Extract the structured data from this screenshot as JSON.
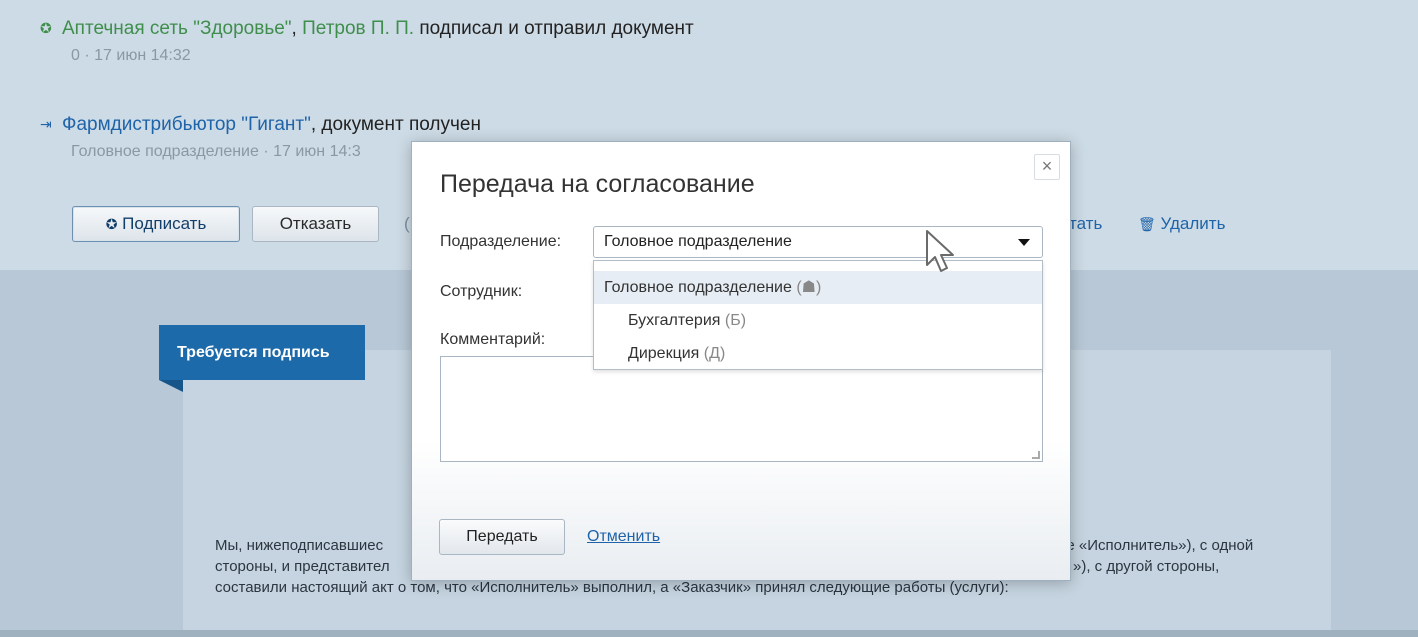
{
  "events": [
    {
      "icon": "certificate-icon",
      "org": "Аптечная сеть \"Здоровье\"",
      "sep": ",",
      "person": "Петров П. П.",
      "action": "подписал и отправил документ",
      "meta_count": "0",
      "meta_dot": "·",
      "meta_time": "17 июн 14:32"
    },
    {
      "icon": "incoming-document-icon",
      "org": "Фармдистрибьютор \"Гигант\"",
      "action": ", документ получен",
      "meta_dept": "Головное подразделение",
      "meta_dot": "·",
      "meta_time": "17 июн 14:3"
    }
  ],
  "toolbar": {
    "sign_label": "Подписать",
    "refuse_label": "Отказать",
    "partial_letter": "(",
    "print_partial": "тать",
    "delete_label": "Удалить"
  },
  "document": {
    "badge": "Требуется подпись",
    "lines": [
      {
        "left": "Мы, нижеподписавшиес",
        "right": "ее «Исполнитель»), с одной"
      },
      {
        "left": "стороны, и представител",
        "right": "»), с другой стороны,"
      },
      {
        "left": "составили настоящий акт о том, что «Исполнитель» выполнил, а «Заказчик» принял следующие работы (услуги):",
        "right": ""
      }
    ]
  },
  "modal": {
    "title": "Передача на согласование",
    "close_symbol": "×",
    "department_label": "Подразделение:",
    "department_value": "Головное подразделение",
    "employee_label": "Сотрудник:",
    "comment_label": "Комментарий:",
    "comment_value": "",
    "options": [
      {
        "name": "Головное подразделение",
        "abbr": "(☗)",
        "highlighted": true
      },
      {
        "name": "Бухгалтерия",
        "abbr": "(Б)",
        "highlighted": false
      },
      {
        "name": "Дирекция",
        "abbr": "(Д)",
        "highlighted": false
      }
    ],
    "submit_label": "Передать",
    "cancel_label": "Отменить"
  },
  "colors": {
    "accent_blue": "#1f63a8",
    "accent_green": "#3f8e4c",
    "badge_blue": "#1d6aaa"
  }
}
